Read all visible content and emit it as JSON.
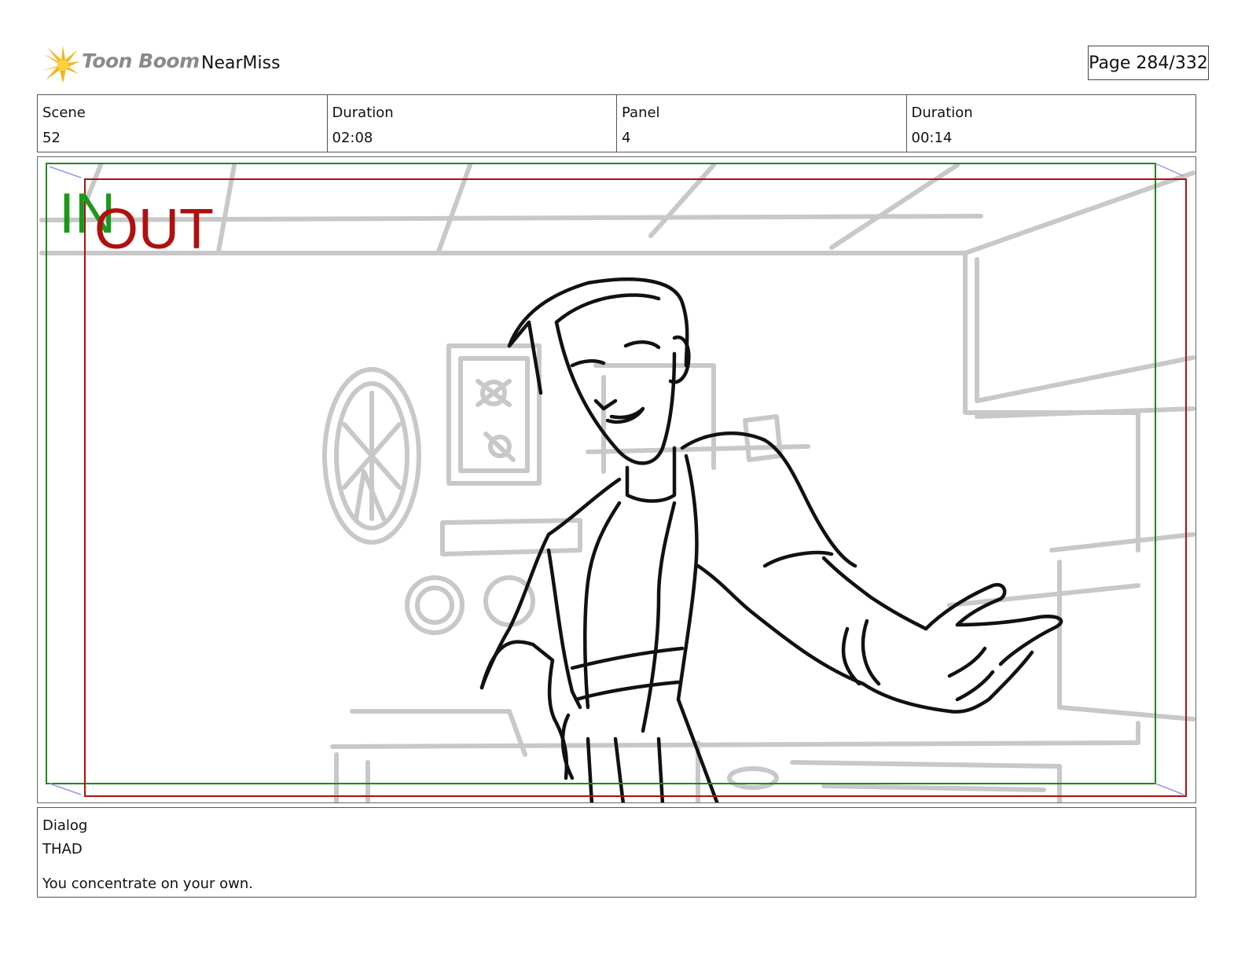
{
  "header": {
    "logo_text": "Toon Boom",
    "project": "NearMiss",
    "page": "Page 284/332"
  },
  "info": {
    "scene_label": "Scene",
    "scene_value": "52",
    "scene_duration_label": "Duration",
    "scene_duration_value": "02:08",
    "panel_label": "Panel",
    "panel_value": "4",
    "panel_duration_label": "Duration",
    "panel_duration_value": "00:14"
  },
  "frame": {
    "in_label": "IN",
    "out_label": "OUT",
    "in_color": "#1a9a1a",
    "out_color": "#b01010"
  },
  "dialog": {
    "label": "Dialog",
    "character": "THAD",
    "line": "You concentrate on your own."
  }
}
